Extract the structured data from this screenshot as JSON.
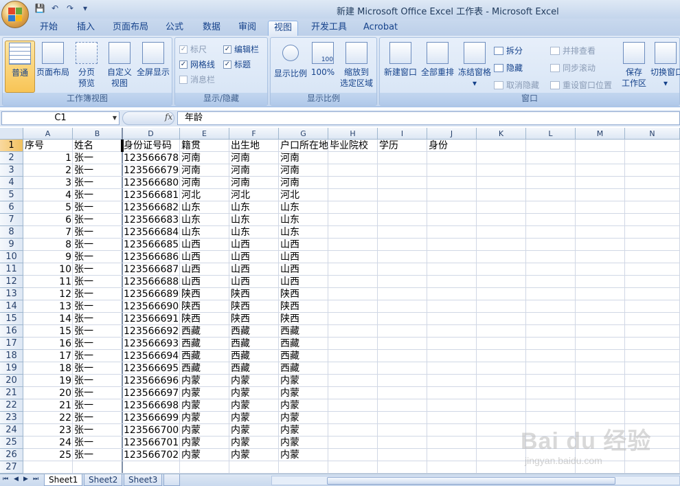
{
  "window": {
    "title": "新建 Microsoft Office Excel 工作表 - Microsoft Excel"
  },
  "qat": {
    "save": "💾",
    "undo": "↶",
    "redo": "↷",
    "customize": "▾"
  },
  "tabs": [
    {
      "label": "开始"
    },
    {
      "label": "插入"
    },
    {
      "label": "页面布局"
    },
    {
      "label": "公式"
    },
    {
      "label": "数据"
    },
    {
      "label": "审阅"
    },
    {
      "label": "视图",
      "active": true
    },
    {
      "label": "开发工具"
    },
    {
      "label": "Acrobat"
    }
  ],
  "ribbon": {
    "workbook_views": {
      "title": "工作簿视图",
      "normal": "普通",
      "page_layout": "页面布局",
      "page_break_1": "分页",
      "page_break_2": "预览",
      "custom_views_1": "自定义",
      "custom_views_2": "视图",
      "full_screen": "全屏显示"
    },
    "show_hide": {
      "title": "显示/隐藏",
      "ruler": "标尺",
      "formula_bar": "编辑栏",
      "gridlines": "网格线",
      "headings": "标题",
      "message_bar": "消息栏",
      "check": "✓"
    },
    "zoom": {
      "title": "显示比例",
      "zoom": "显示比例",
      "hundred": "100%",
      "zoom_sel_1": "缩放到",
      "zoom_sel_2": "选定区域",
      "page_text": "100"
    },
    "window": {
      "title": "窗口",
      "new_window": "新建窗口",
      "arrange_all": "全部重排",
      "freeze_panes": "冻结窗格",
      "split": "拆分",
      "hide": "隐藏",
      "unhide": "取消隐藏",
      "side_by_side": "并排查看",
      "sync_scroll": "同步滚动",
      "reset_pos": "重设窗口位置",
      "save_ws_1": "保存",
      "save_ws_2": "工作区",
      "switch_win": "切换窗口",
      "dropdown": "▾"
    }
  },
  "formula_bar": {
    "name_box": "C1",
    "fx": "fx",
    "value": "年龄"
  },
  "sheet": {
    "columns": [
      "A",
      "B",
      "D",
      "E",
      "F",
      "G",
      "H",
      "I",
      "J",
      "K",
      "L",
      "M",
      "N"
    ],
    "rows": [
      "1",
      "2",
      "3",
      "4",
      "5",
      "6",
      "7",
      "8",
      "9",
      "10",
      "11",
      "12",
      "13",
      "14",
      "15",
      "16",
      "17",
      "18",
      "19",
      "20",
      "21",
      "22",
      "23",
      "24",
      "25",
      "26",
      "27"
    ],
    "header_row": [
      "序号",
      "姓名",
      "身份证号码",
      "籍贯",
      "出生地",
      "户口所在地",
      "毕业院校",
      "学历",
      "身份"
    ],
    "data": [
      [
        "1",
        "张一",
        "123566678",
        "河南",
        "河南",
        "河南"
      ],
      [
        "2",
        "张一",
        "123566679",
        "河南",
        "河南",
        "河南"
      ],
      [
        "3",
        "张一",
        "123566680",
        "河南",
        "河南",
        "河南"
      ],
      [
        "4",
        "张一",
        "123566681",
        "河北",
        "河北",
        "河北"
      ],
      [
        "5",
        "张一",
        "123566682",
        "山东",
        "山东",
        "山东"
      ],
      [
        "6",
        "张一",
        "123566683",
        "山东",
        "山东",
        "山东"
      ],
      [
        "7",
        "张一",
        "123566684",
        "山东",
        "山东",
        "山东"
      ],
      [
        "8",
        "张一",
        "123566685",
        "山西",
        "山西",
        "山西"
      ],
      [
        "9",
        "张一",
        "123566686",
        "山西",
        "山西",
        "山西"
      ],
      [
        "10",
        "张一",
        "123566687",
        "山西",
        "山西",
        "山西"
      ],
      [
        "11",
        "张一",
        "123566688",
        "山西",
        "山西",
        "山西"
      ],
      [
        "12",
        "张一",
        "123566689",
        "陕西",
        "陕西",
        "陕西"
      ],
      [
        "13",
        "张一",
        "123566690",
        "陕西",
        "陕西",
        "陕西"
      ],
      [
        "14",
        "张一",
        "123566691",
        "陕西",
        "陕西",
        "陕西"
      ],
      [
        "15",
        "张一",
        "123566692",
        "西藏",
        "西藏",
        "西藏"
      ],
      [
        "16",
        "张一",
        "123566693",
        "西藏",
        "西藏",
        "西藏"
      ],
      [
        "17",
        "张一",
        "123566694",
        "西藏",
        "西藏",
        "西藏"
      ],
      [
        "18",
        "张一",
        "123566695",
        "西藏",
        "西藏",
        "西藏"
      ],
      [
        "19",
        "张一",
        "123566696",
        "内蒙",
        "内蒙",
        "内蒙"
      ],
      [
        "20",
        "张一",
        "123566697",
        "内蒙",
        "内蒙",
        "内蒙"
      ],
      [
        "21",
        "张一",
        "123566698",
        "内蒙",
        "内蒙",
        "内蒙"
      ],
      [
        "22",
        "张一",
        "123566699",
        "内蒙",
        "内蒙",
        "内蒙"
      ],
      [
        "23",
        "张一",
        "123566700",
        "内蒙",
        "内蒙",
        "内蒙"
      ],
      [
        "24",
        "张一",
        "123566701",
        "内蒙",
        "内蒙",
        "内蒙"
      ],
      [
        "25",
        "张一",
        "123566702",
        "内蒙",
        "内蒙",
        "内蒙"
      ]
    ]
  },
  "sheet_tabs": {
    "nav": [
      "⏮",
      "◀",
      "▶",
      "⏭"
    ],
    "tabs": [
      {
        "label": "Sheet1",
        "active": true
      },
      {
        "label": "Sheet2"
      },
      {
        "label": "Sheet3"
      }
    ]
  },
  "watermark": {
    "line1": "Bai du 经验",
    "line2": "jingyan.baidu.com"
  },
  "colors": {
    "accent": "#15428b",
    "ribbon_bg": "#dfe9f6",
    "selected_header": "#f1c15f"
  }
}
